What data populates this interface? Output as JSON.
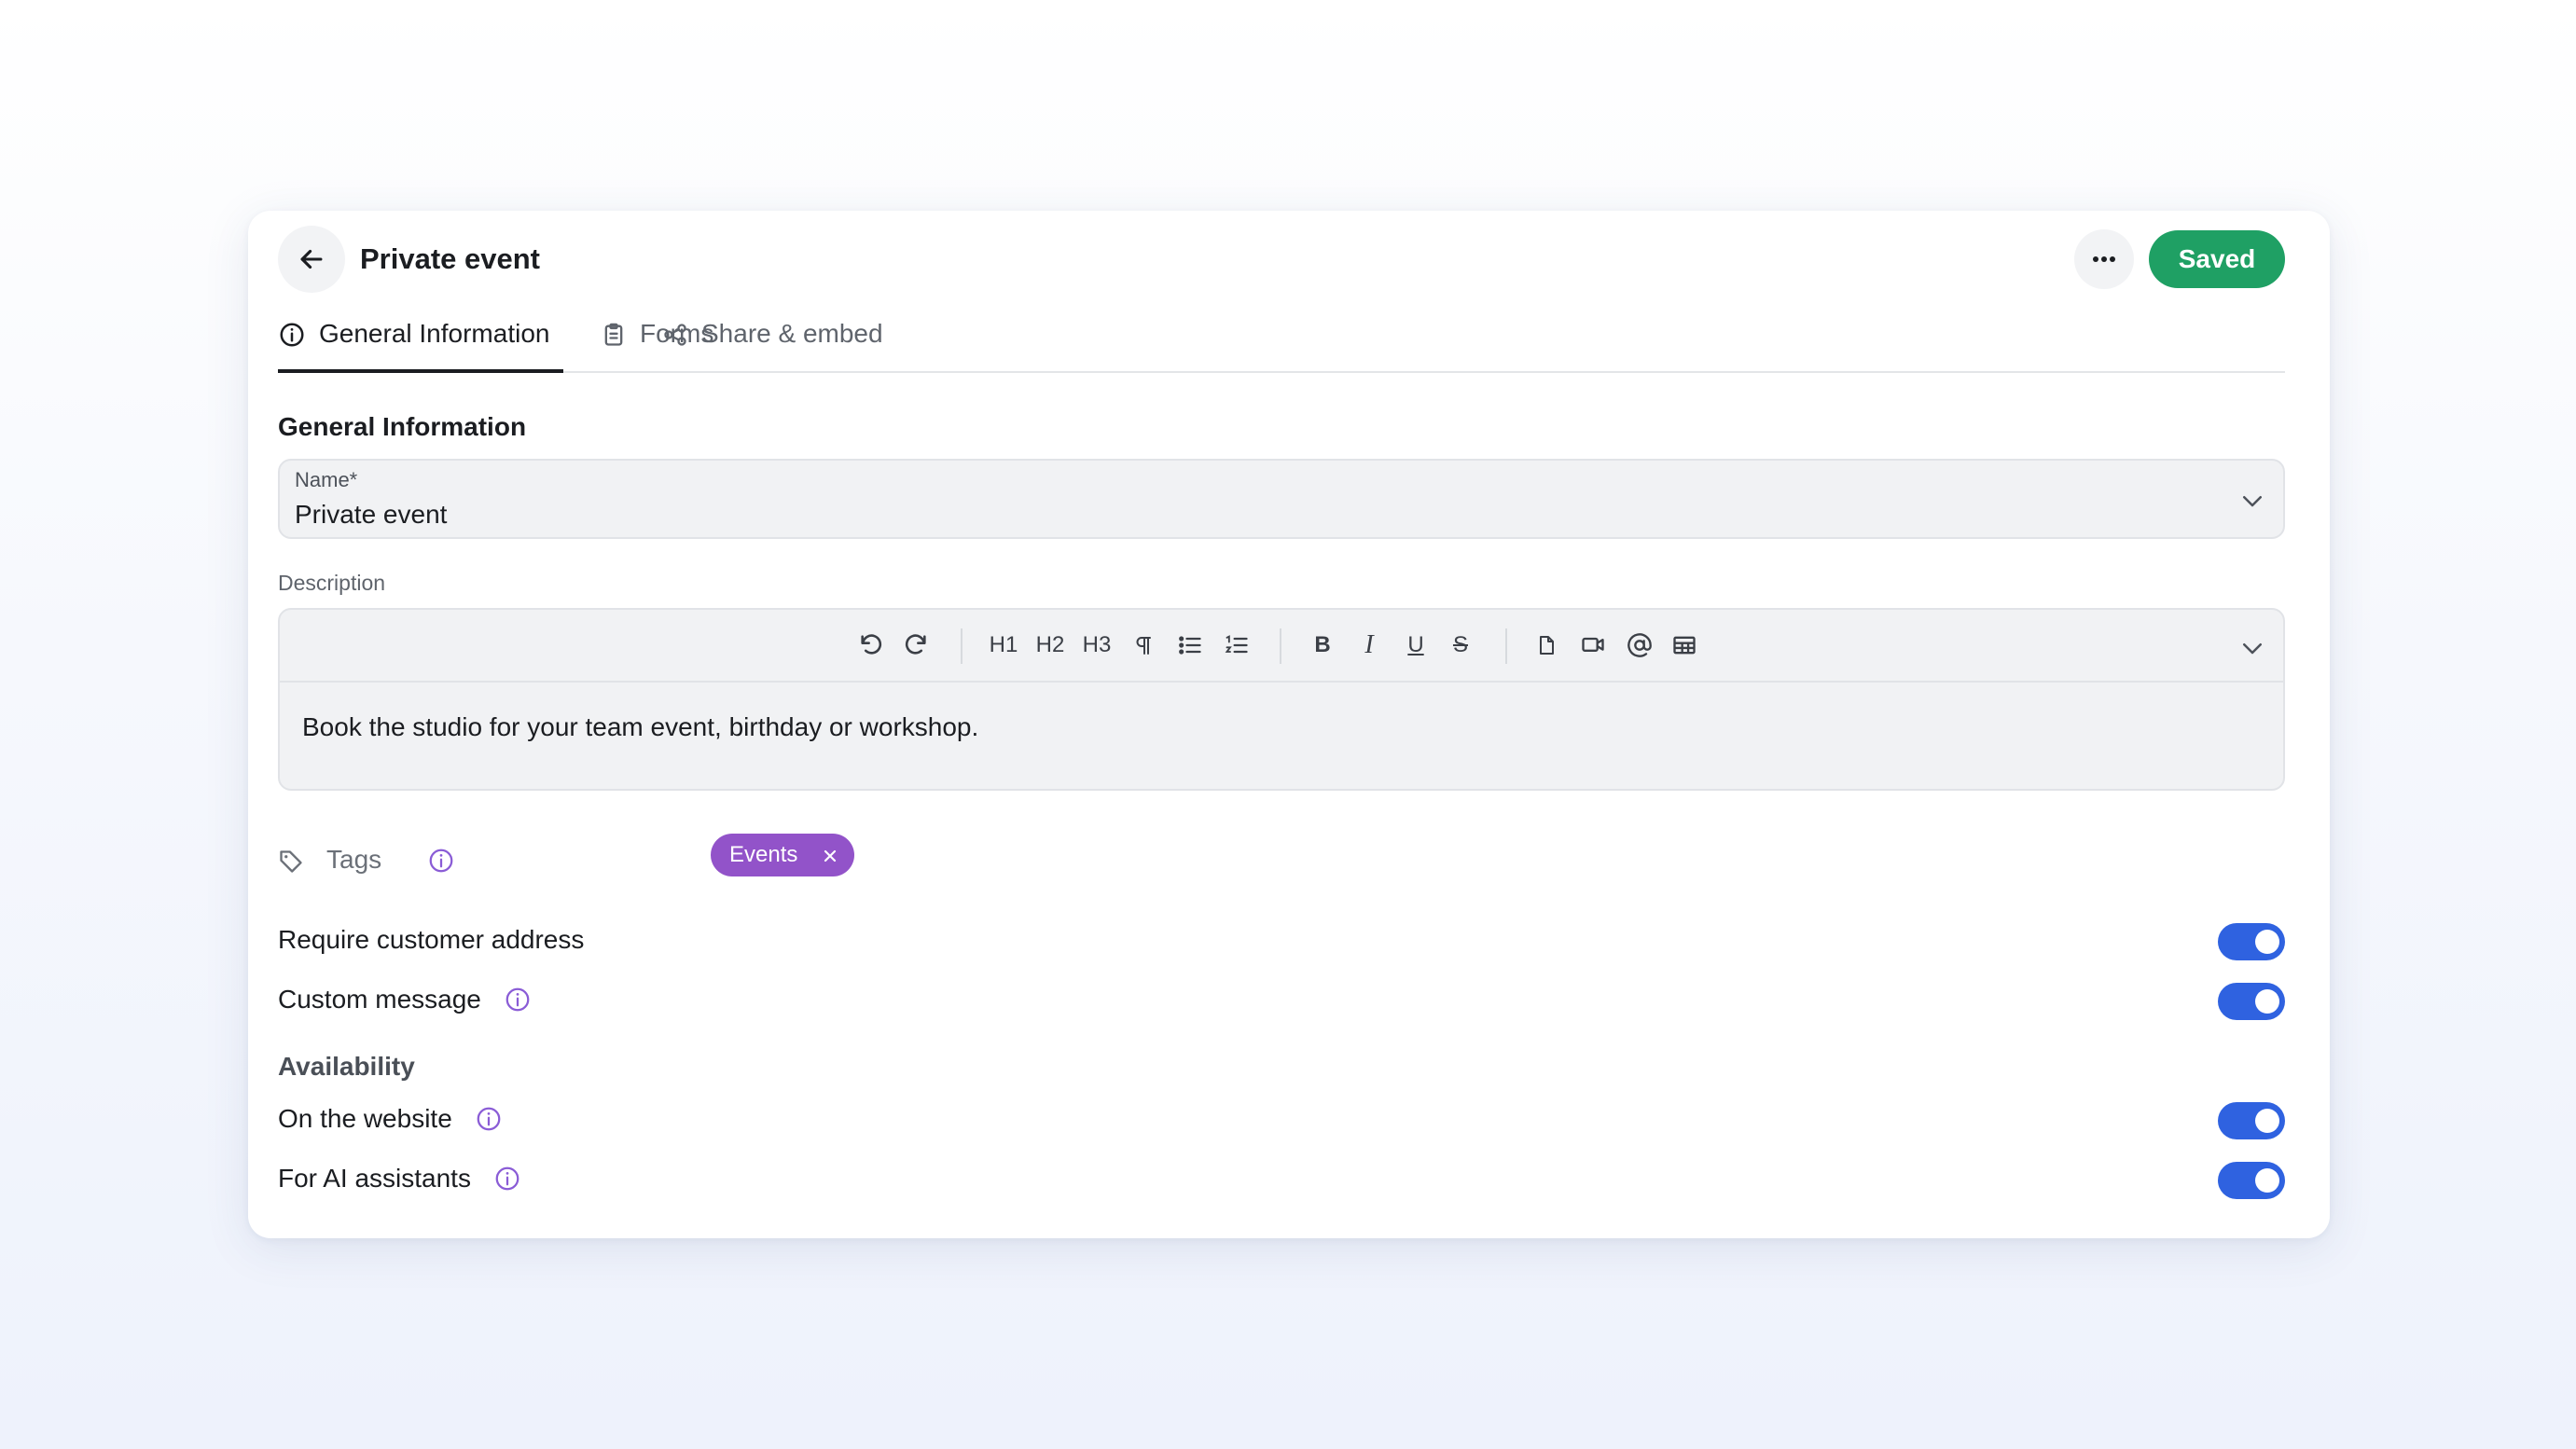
{
  "header": {
    "title": "Private event",
    "saved_label": "Saved"
  },
  "tabs": [
    {
      "label": "General Information",
      "icon": "info-icon",
      "active": true
    },
    {
      "label": "Forms",
      "icon": "clipboard-icon"
    },
    {
      "label": "Share & embed",
      "icon": "share-icon"
    }
  ],
  "general": {
    "section_title": "General Information",
    "name_label": "Name*",
    "name_value": "Private event",
    "description_label": "Description",
    "description_text": "Book the studio for your team event, birthday or workshop."
  },
  "toolbar": {
    "h1": "H1",
    "h2": "H2",
    "h3": "H3",
    "bold": "B",
    "italic": "I",
    "underline": "U",
    "strike": "S"
  },
  "tags": {
    "label": "Tags",
    "chips": [
      "Events"
    ],
    "chip_color": "#9253c9"
  },
  "settings": {
    "require_address": "Require customer address",
    "custom_message": "Custom message",
    "availability_title": "Availability",
    "on_website": "On the website",
    "for_ai": "For AI assistants"
  },
  "colors": {
    "accent": "#2f62e0",
    "saved_green": "#1fa064",
    "info_purple": "#8a5cd6"
  }
}
